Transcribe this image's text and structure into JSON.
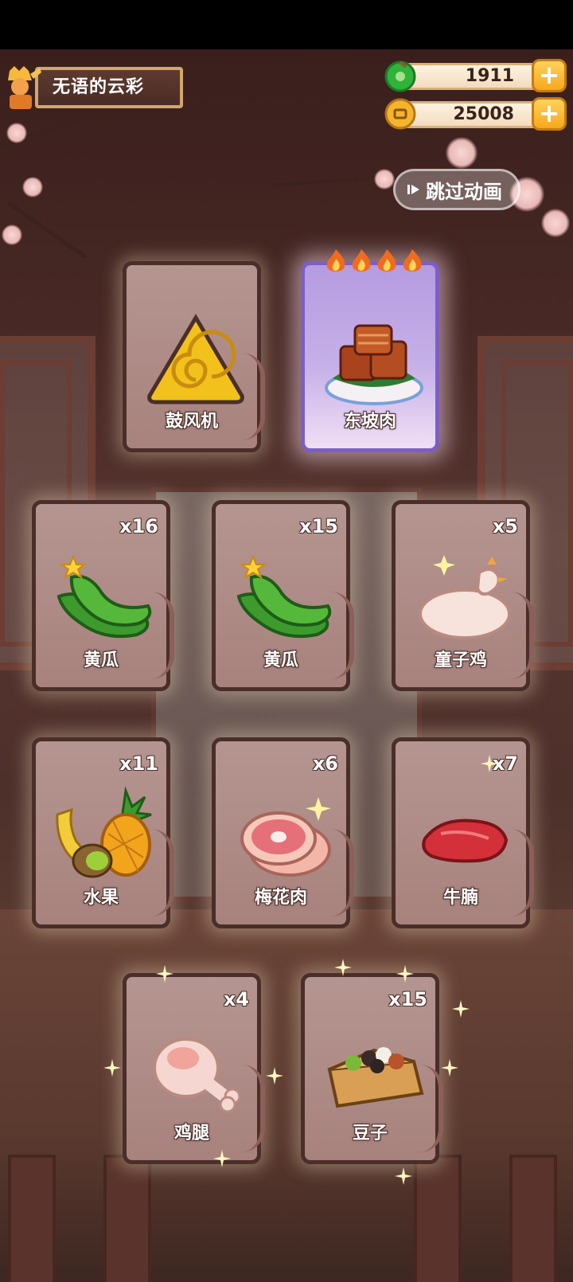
{
  "player": {
    "name": "无语的云彩"
  },
  "currency": {
    "jade": "1911",
    "coins": "25008",
    "colors": {
      "jade": "#2fb33a",
      "coin": "#f4b52a"
    }
  },
  "skip_button": {
    "label": "跳过动画"
  },
  "cards": [
    {
      "name": "鼓风机",
      "count": "",
      "rarity": "common",
      "icon": "spiral-triangle-icon"
    },
    {
      "name": "东坡肉",
      "count": "",
      "rarity": "epic",
      "stars": 4,
      "icon": "braised-pork-icon"
    },
    {
      "name": "黄瓜",
      "count": "x16",
      "rarity": "common",
      "icon": "cucumber-icon"
    },
    {
      "name": "黄瓜",
      "count": "x15",
      "rarity": "common",
      "icon": "cucumber-icon"
    },
    {
      "name": "童子鸡",
      "count": "x5",
      "rarity": "common",
      "icon": "chicken-icon"
    },
    {
      "name": "水果",
      "count": "x11",
      "rarity": "common",
      "icon": "fruit-icon"
    },
    {
      "name": "梅花肉",
      "count": "x6",
      "rarity": "common",
      "icon": "pork-shoulder-icon"
    },
    {
      "name": "牛腩",
      "count": "x7",
      "rarity": "common",
      "icon": "beef-brisket-icon"
    },
    {
      "name": "鸡腿",
      "count": "x4",
      "rarity": "common",
      "icon": "drumstick-icon"
    },
    {
      "name": "豆子",
      "count": "x15",
      "rarity": "common",
      "icon": "beans-box-icon"
    }
  ]
}
